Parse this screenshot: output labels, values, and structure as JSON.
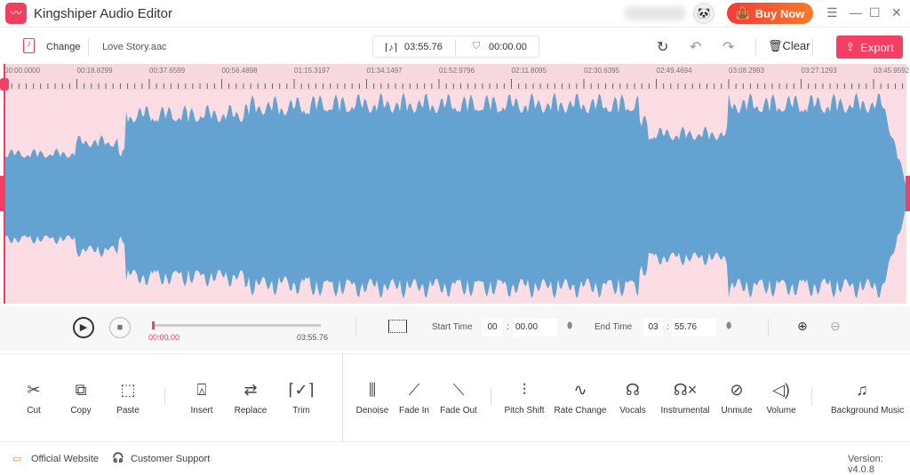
{
  "app": {
    "title": "Kingshiper Audio Editor",
    "buy_now": "Buy Now",
    "icons": [
      "app-logo-icon",
      "avatar-icon",
      "bag-icon",
      "menu-icon",
      "minimize-icon",
      "maximize-icon",
      "close-icon"
    ]
  },
  "toolbar": {
    "change": "Change",
    "file_name": "Love Story.aac",
    "duration": "03:55.76",
    "selection": "00:00.00",
    "clear": "Clear",
    "export": "Export"
  },
  "ruler": {
    "labels": [
      "00:00.0000",
      "00:18.8299",
      "00:37.6599",
      "00:56.4898",
      "01:15.3197",
      "01:34.1497",
      "01:52.9796",
      "02:11.8095",
      "02:30.6395",
      "02:49.4694",
      "03:08.2993",
      "03:27.1293",
      "03:45.9592"
    ]
  },
  "colors": {
    "accent": "#f43e63",
    "waveform": "#64a2d2",
    "waveform_bg": "#fbdde3"
  },
  "playback": {
    "current": "00:00.00",
    "total": "03:55.76",
    "progress": 0
  },
  "range": {
    "start_label": "Start Time",
    "start_min": "00",
    "start_sec": "00.00",
    "end_label": "End Time",
    "end_min": "03",
    "end_sec": "55.76"
  },
  "tools": [
    {
      "label": "Cut",
      "icon": "✂"
    },
    {
      "label": "Copy",
      "icon": "⧉"
    },
    {
      "label": "Paste",
      "icon": "⬚"
    },
    {
      "label": "Insert",
      "icon": "⍓"
    },
    {
      "label": "Replace",
      "icon": "⇄"
    },
    {
      "label": "Trim",
      "icon": "⌈✓⌉"
    },
    {
      "label": "Denoise",
      "icon": "⫼"
    },
    {
      "label": "Fade In",
      "icon": "⟋"
    },
    {
      "label": "Fade Out",
      "icon": "⟍"
    },
    {
      "label": "Pitch Shift",
      "icon": "⫶"
    },
    {
      "label": "Rate Change",
      "icon": "∿"
    },
    {
      "label": "Vocals",
      "icon": "☊"
    },
    {
      "label": "Instrumental",
      "icon": "☊×"
    },
    {
      "label": "Unmute",
      "icon": "⊘"
    },
    {
      "label": "Volume",
      "icon": "◁)"
    },
    {
      "label": "Background Music",
      "icon": "♫"
    }
  ],
  "footer": {
    "website": "Official Website",
    "support": "Customer Support",
    "version": "Version: v4.0.8"
  }
}
